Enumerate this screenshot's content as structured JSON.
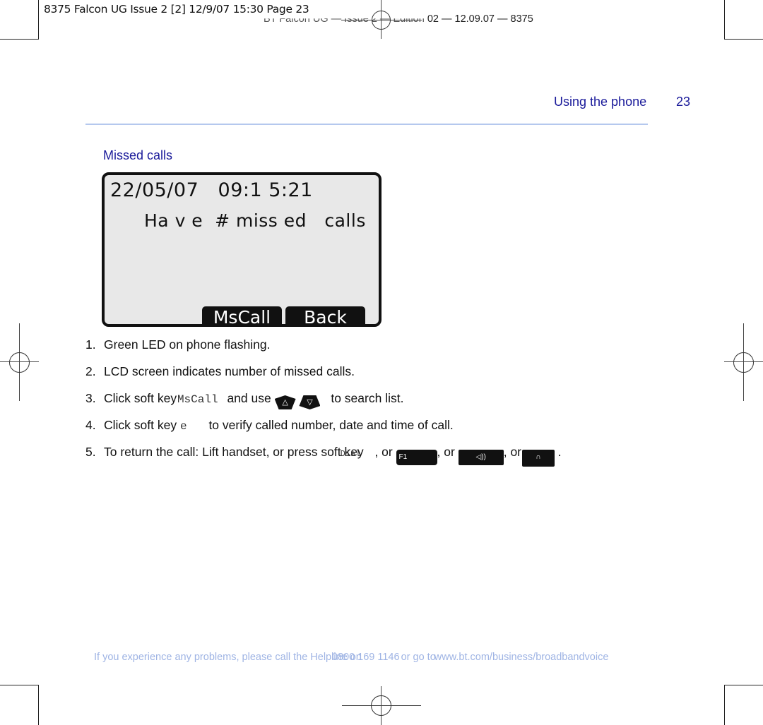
{
  "slug": {
    "print_info": "8375 Falcon UG Issue 2 [2]  12/9/07  15:30  Page 23",
    "edition_line_left": "BT Falcon UG — Issue 2 — Edition",
    "edition_line_right": "02 — 12.09.07 — 8375"
  },
  "header": {
    "running_head": "Using the phone",
    "page_number": "23"
  },
  "section": {
    "title": "Missed calls"
  },
  "lcd": {
    "line1": "22/05/07   09:1 5:21",
    "line2": "Ha v e  # miss ed   calls",
    "softkeys": [
      "MsCall",
      "Back"
    ]
  },
  "steps": [
    {
      "num": "1.",
      "text": "Green LED on phone flashing."
    },
    {
      "num": "2.",
      "text": "LCD screen indicates number of missed calls."
    },
    {
      "num": "3.",
      "pre": "Click soft key",
      "key": "MsCall",
      "mid": "and use",
      "icons": [
        "up-arrow-key",
        "down-arrow-key"
      ],
      "post": "to search list."
    },
    {
      "num": "4.",
      "pre": "Click soft key",
      "key": "e",
      "post": "to verify called number, date and time of call."
    },
    {
      "num": "5.",
      "pre": "To return the call: Lift handset, or press soft key",
      "key": "Dial",
      "or1": ", or",
      "f1_label": "F1",
      "or2": ", or",
      "speaker_icon": "speaker-icon",
      "or3": ", or",
      "headset_icon": "headset-icon",
      "end": "."
    }
  ],
  "footer": {
    "pre": "If you experience any problems, please call the Helpline on",
    "phone": "0800 169 1146",
    "mid": "or go to",
    "url": "www.bt.com/business/broadbandvoice"
  }
}
